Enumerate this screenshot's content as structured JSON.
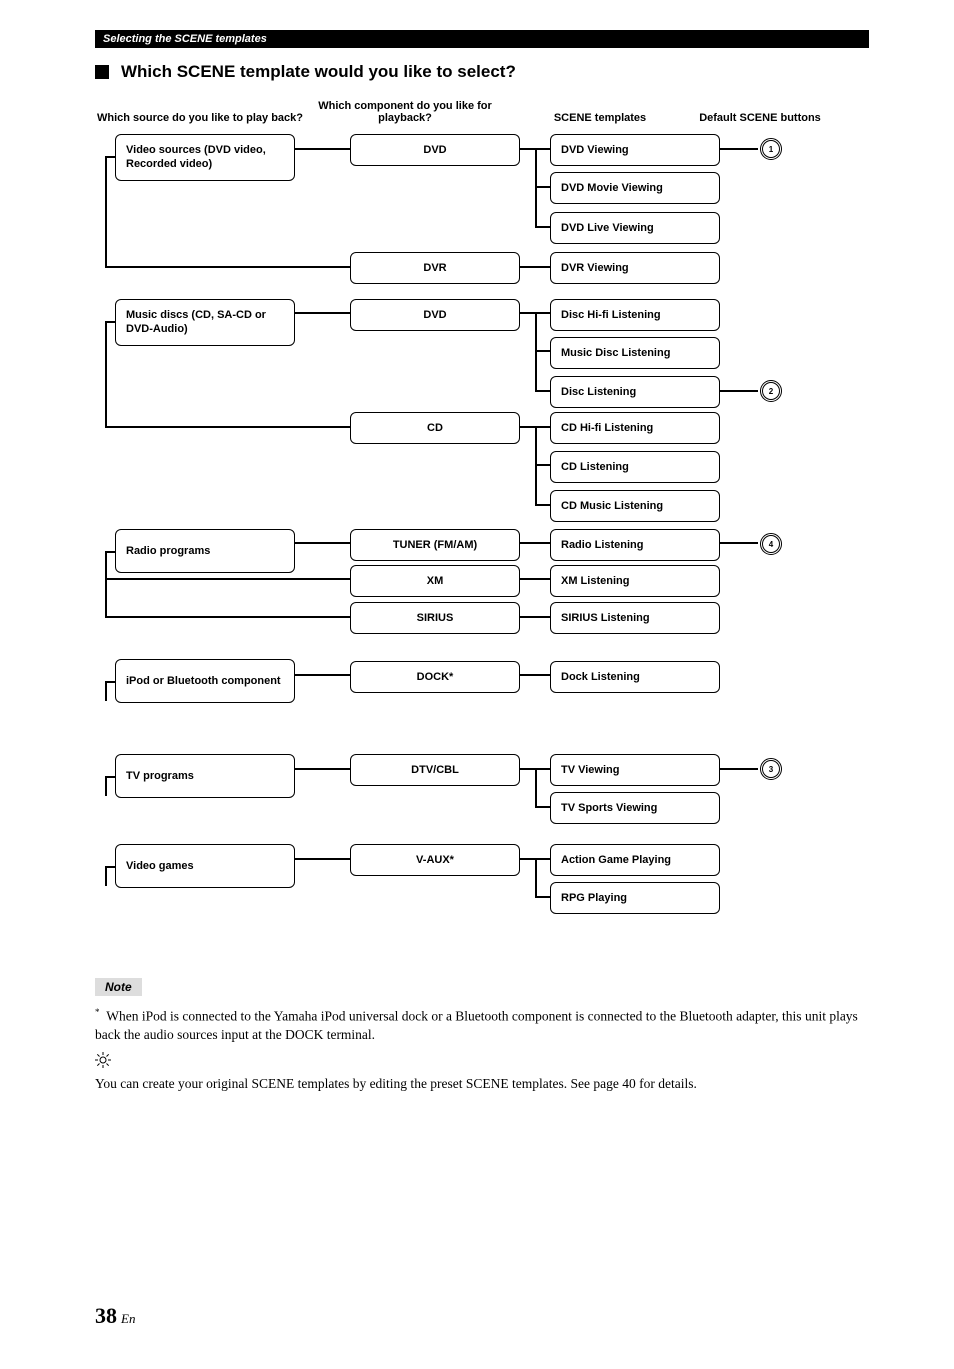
{
  "header_bar": "Selecting the SCENE templates",
  "section_title": "Which SCENE template would you like to select?",
  "col_headers": {
    "q1": "Which source do you like to play back?",
    "q2": "Which component do you like for playback?",
    "q3": "SCENE templates",
    "q4": "Default SCENE buttons"
  },
  "sources": {
    "video": "Video sources (DVD video, Recorded video)",
    "music": "Music discs (CD, SA-CD or DVD-Audio)",
    "radio": "Radio programs",
    "ipod": "iPod or Bluetooth component",
    "tv": "TV programs",
    "games": "Video games"
  },
  "components": {
    "dvd": "DVD",
    "dvr": "DVR",
    "dvd2": "DVD",
    "cd": "CD",
    "tuner": "TUNER (FM/AM)",
    "xm": "XM",
    "sirius": "SIRIUS",
    "dock": "DOCK*",
    "dtv": "DTV/CBL",
    "vaux": "V-AUX*"
  },
  "templates": {
    "dvd_view": "DVD Viewing",
    "dvd_movie": "DVD Movie Viewing",
    "dvd_live": "DVD Live Viewing",
    "dvr_view": "DVR Viewing",
    "disc_hifi": "Disc Hi-fi Listening",
    "music_disc": "Music Disc Listening",
    "disc_listen": "Disc Listening",
    "cd_hifi": "CD Hi-fi Listening",
    "cd_listen": "CD Listening",
    "cd_music": "CD Music Listening",
    "radio_listen": "Radio Listening",
    "xm_listen": "XM Listening",
    "sirius_listen": "SIRIUS Listening",
    "dock_listen": "Dock Listening",
    "tv_view": "TV Viewing",
    "tv_sports": "TV Sports Viewing",
    "action_game": "Action Game Playing",
    "rpg": "RPG Playing"
  },
  "buttons": {
    "b1": "1",
    "b2": "2",
    "b3": "3",
    "b4": "4"
  },
  "note_label": "Note",
  "note_body": "When iPod is connected to the Yamaha iPod universal dock or a Bluetooth component is connected to the Bluetooth adapter, this unit plays back the audio sources input at the DOCK terminal.",
  "hint_body": "You can create your original SCENE templates by editing the preset SCENE templates. See page 40 for details.",
  "page_number": "38",
  "page_lang": "En",
  "asterisk": "*",
  "chart_data": {
    "type": "tree-diagram",
    "levels": [
      "source",
      "component",
      "scene_template",
      "default_button"
    ],
    "tree": [
      {
        "source": "Video sources (DVD video, Recorded video)",
        "children": [
          {
            "component": "DVD",
            "templates": [
              "DVD Viewing",
              "DVD Movie Viewing",
              "DVD Live Viewing"
            ],
            "default_button_for": {
              "DVD Viewing": 1
            }
          },
          {
            "component": "DVR",
            "templates": [
              "DVR Viewing"
            ]
          }
        ]
      },
      {
        "source": "Music discs (CD, SA-CD or DVD-Audio)",
        "children": [
          {
            "component": "DVD",
            "templates": [
              "Disc Hi-fi Listening",
              "Music Disc Listening",
              "Disc Listening"
            ],
            "default_button_for": {
              "Disc Listening": 2
            }
          },
          {
            "component": "CD",
            "templates": [
              "CD Hi-fi Listening",
              "CD Listening",
              "CD Music Listening"
            ]
          }
        ]
      },
      {
        "source": "Radio programs",
        "children": [
          {
            "component": "TUNER (FM/AM)",
            "templates": [
              "Radio Listening"
            ],
            "default_button_for": {
              "Radio Listening": 4
            }
          },
          {
            "component": "XM",
            "templates": [
              "XM Listening"
            ]
          },
          {
            "component": "SIRIUS",
            "templates": [
              "SIRIUS Listening"
            ]
          }
        ]
      },
      {
        "source": "iPod or Bluetooth component",
        "children": [
          {
            "component": "DOCK*",
            "templates": [
              "Dock Listening"
            ]
          }
        ]
      },
      {
        "source": "TV programs",
        "children": [
          {
            "component": "DTV/CBL",
            "templates": [
              "TV Viewing",
              "TV Sports Viewing"
            ],
            "default_button_for": {
              "TV Viewing": 3
            }
          }
        ]
      },
      {
        "source": "Video games",
        "children": [
          {
            "component": "V-AUX*",
            "templates": [
              "Action Game Playing",
              "RPG Playing"
            ]
          }
        ]
      }
    ]
  }
}
